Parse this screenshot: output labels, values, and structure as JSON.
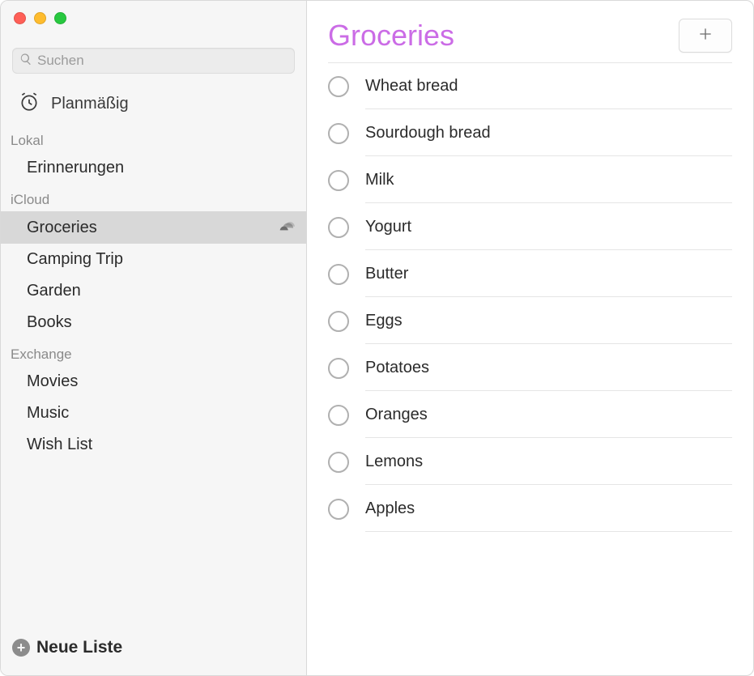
{
  "colors": {
    "accent": "#cb6ce6"
  },
  "search": {
    "placeholder": "Suchen"
  },
  "scheduled": {
    "label": "Planmäßig"
  },
  "sections": [
    {
      "header": "Lokal",
      "items": [
        {
          "label": "Erinnerungen",
          "selected": false,
          "shared": false
        }
      ]
    },
    {
      "header": "iCloud",
      "items": [
        {
          "label": "Groceries",
          "selected": true,
          "shared": true
        },
        {
          "label": "Camping Trip",
          "selected": false,
          "shared": false
        },
        {
          "label": "Garden",
          "selected": false,
          "shared": false
        },
        {
          "label": "Books",
          "selected": false,
          "shared": false
        }
      ]
    },
    {
      "header": "Exchange",
      "items": [
        {
          "label": "Movies",
          "selected": false,
          "shared": false
        },
        {
          "label": "Music",
          "selected": false,
          "shared": false
        },
        {
          "label": "Wish List",
          "selected": false,
          "shared": false
        }
      ]
    }
  ],
  "footer": {
    "new_list_label": "Neue Liste"
  },
  "main": {
    "title": "Groceries"
  },
  "reminders": [
    {
      "text": "Wheat bread",
      "completed": false
    },
    {
      "text": "Sourdough bread",
      "completed": false
    },
    {
      "text": "Milk",
      "completed": false
    },
    {
      "text": "Yogurt",
      "completed": false
    },
    {
      "text": "Butter",
      "completed": false
    },
    {
      "text": "Eggs",
      "completed": false
    },
    {
      "text": "Potatoes",
      "completed": false
    },
    {
      "text": "Oranges",
      "completed": false
    },
    {
      "text": "Lemons",
      "completed": false
    },
    {
      "text": "Apples",
      "completed": false
    }
  ]
}
